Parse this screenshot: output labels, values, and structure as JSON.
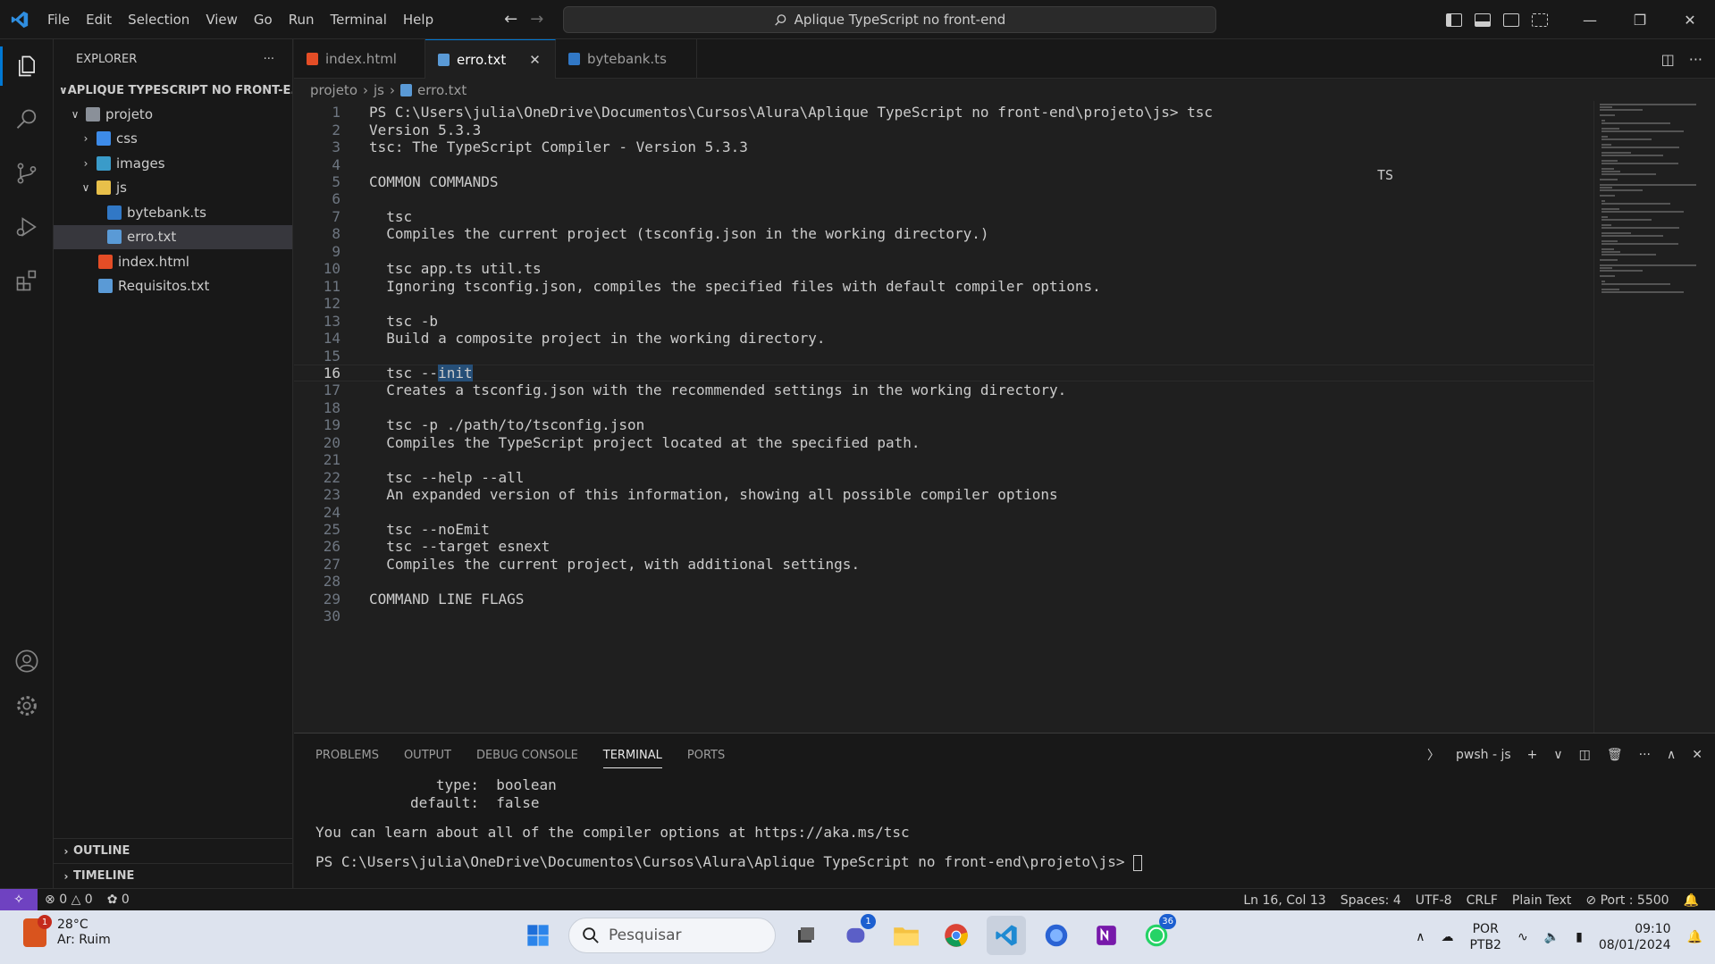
{
  "titlebar": {
    "menu": [
      "File",
      "Edit",
      "Selection",
      "View",
      "Go",
      "Run",
      "Terminal",
      "Help"
    ],
    "command_center": "Aplique TypeScript no front-end"
  },
  "sidebar": {
    "title": "EXPLORER",
    "folder": "APLIQUE TYPESCRIPT NO FRONT-E...",
    "tree": [
      {
        "label": "projeto",
        "type": "folder",
        "depth": 1,
        "expanded": true
      },
      {
        "label": "css",
        "type": "folder",
        "depth": 2,
        "expanded": false
      },
      {
        "label": "images",
        "type": "folder",
        "depth": 2,
        "expanded": false
      },
      {
        "label": "js",
        "type": "folder",
        "depth": 2,
        "expanded": true
      },
      {
        "label": "bytebank.ts",
        "type": "ts",
        "depth": 3
      },
      {
        "label": "erro.txt",
        "type": "txt",
        "depth": 3,
        "selected": true
      },
      {
        "label": "index.html",
        "type": "html",
        "depth": 2
      },
      {
        "label": "Requisitos.txt",
        "type": "txt",
        "depth": 2
      }
    ],
    "outline": "OUTLINE",
    "timeline": "TIMELINE"
  },
  "tabs": [
    {
      "label": "index.html",
      "icon": "html-file-icon",
      "active": false
    },
    {
      "label": "erro.txt",
      "icon": "text-file-icon",
      "active": true
    },
    {
      "label": "bytebank.ts",
      "icon": "ts-file-icon",
      "active": false
    }
  ],
  "breadcrumb": [
    "projeto",
    "js",
    "erro.txt"
  ],
  "editor": {
    "active_line": 16,
    "ts_hint": "TS",
    "lines": [
      "PS C:\\Users\\julia\\OneDrive\\Documentos\\Cursos\\Alura\\Aplique TypeScript no front-end\\projeto\\js> tsc",
      "Version 5.3.3",
      "tsc: The TypeScript Compiler - Version 5.3.3",
      "",
      "COMMON COMMANDS",
      "",
      "  tsc",
      "  Compiles the current project (tsconfig.json in the working directory.)",
      "",
      "  tsc app.ts util.ts",
      "  Ignoring tsconfig.json, compiles the specified files with default compiler options.",
      "",
      "  tsc -b",
      "  Build a composite project in the working directory.",
      "",
      "  tsc --init",
      "  Creates a tsconfig.json with the recommended settings in the working directory.",
      "",
      "  tsc -p ./path/to/tsconfig.json",
      "  Compiles the TypeScript project located at the specified path.",
      "",
      "  tsc --help --all",
      "  An expanded version of this information, showing all possible compiler options",
      "",
      "  tsc --noEmit",
      "  tsc --target esnext",
      "  Compiles the current project, with additional settings.",
      "",
      "COMMAND LINE FLAGS",
      ""
    ]
  },
  "panel": {
    "tabs": [
      "PROBLEMS",
      "OUTPUT",
      "DEBUG CONSOLE",
      "TERMINAL",
      "PORTS"
    ],
    "active_tab": "TERMINAL",
    "shell": "pwsh - js",
    "terminal_lines": [
      "              type:  boolean",
      "           default:  false",
      "",
      "You can learn about all of the compiler options at https://aka.ms/tsc",
      "",
      "PS C:\\Users\\julia\\OneDrive\\Documentos\\Cursos\\Alura\\Aplique TypeScript no front-end\\projeto\\js> "
    ]
  },
  "statusbar": {
    "errors": "0",
    "warnings": "0",
    "ports_forwarded": "0",
    "position": "Ln 16, Col 13",
    "spaces": "Spaces: 4",
    "encoding": "UTF-8",
    "eol": "CRLF",
    "language": "Plain Text",
    "port": "Port : 5500"
  },
  "taskbar": {
    "weather_temp": "28°C",
    "weather_desc": "Ar: Ruim",
    "weather_badge": "1",
    "search_placeholder": "Pesquisar",
    "teams_badge": "1",
    "whatsapp_badge": "36",
    "lang_line1": "POR",
    "lang_line2": "PTB2",
    "time": "09:10",
    "date": "08/01/2024"
  },
  "colors": {
    "accent": "#0078d4",
    "remote": "#6f42c1",
    "selection": "#264f78"
  }
}
